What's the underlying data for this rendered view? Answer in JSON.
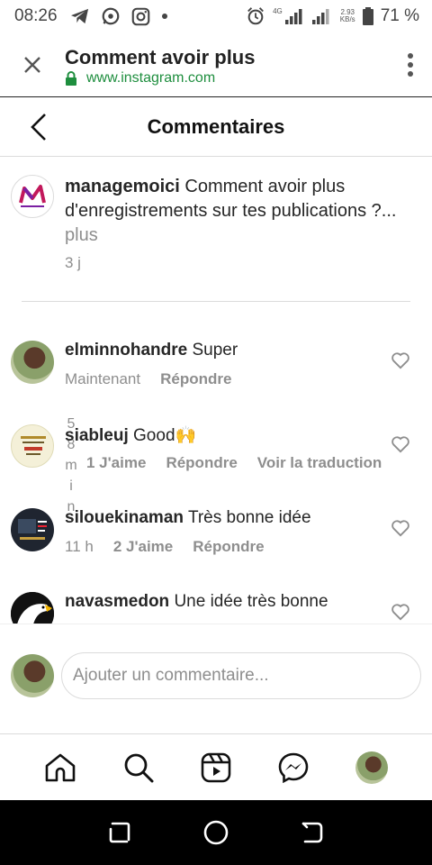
{
  "status_bar": {
    "time": "08:26",
    "net_label": "4G",
    "speed_value": "2.93",
    "speed_unit": "KB/s",
    "battery": "71 %"
  },
  "browser": {
    "title": "Comment avoir plus",
    "url": "www.instagram.com",
    "url_color": "#1e8e3e"
  },
  "header": {
    "title": "Commentaires"
  },
  "caption": {
    "username": "managemoici",
    "text": "Comment avoir plus d'enregistrements sur tes publications ?...",
    "more": "plus",
    "time": "3 j"
  },
  "comments": [
    {
      "username": "elminnohandre",
      "text": "Super",
      "time": "Maintenant",
      "likes": "",
      "reply": "Répondre",
      "translate": ""
    },
    {
      "username": "siableuj",
      "text": "Good🙌",
      "time_chars": [
        "5",
        "8",
        "m",
        "i",
        "n"
      ],
      "likes": "1 J'aime",
      "reply": "Répondre",
      "translate": "Voir la traduction"
    },
    {
      "username": "silouekinaman",
      "text": "Très bonne idée",
      "time": "11 h",
      "likes": "2 J'aime",
      "reply": "Répondre",
      "translate": ""
    },
    {
      "username": "navasmedon",
      "text": "Une idée très bonne",
      "time": "",
      "likes": "",
      "reply": "",
      "translate": ""
    }
  ],
  "add_comment": {
    "placeholder": "Ajouter un commentaire..."
  },
  "icons": {
    "status": [
      "telegram-icon",
      "whatsapp-icon",
      "instagram-icon",
      "dot-icon",
      "alarm-icon",
      "signal-icon",
      "battery-icon"
    ],
    "nav": [
      "home-icon",
      "search-icon",
      "reels-icon",
      "messenger-icon",
      "profile-avatar"
    ]
  }
}
